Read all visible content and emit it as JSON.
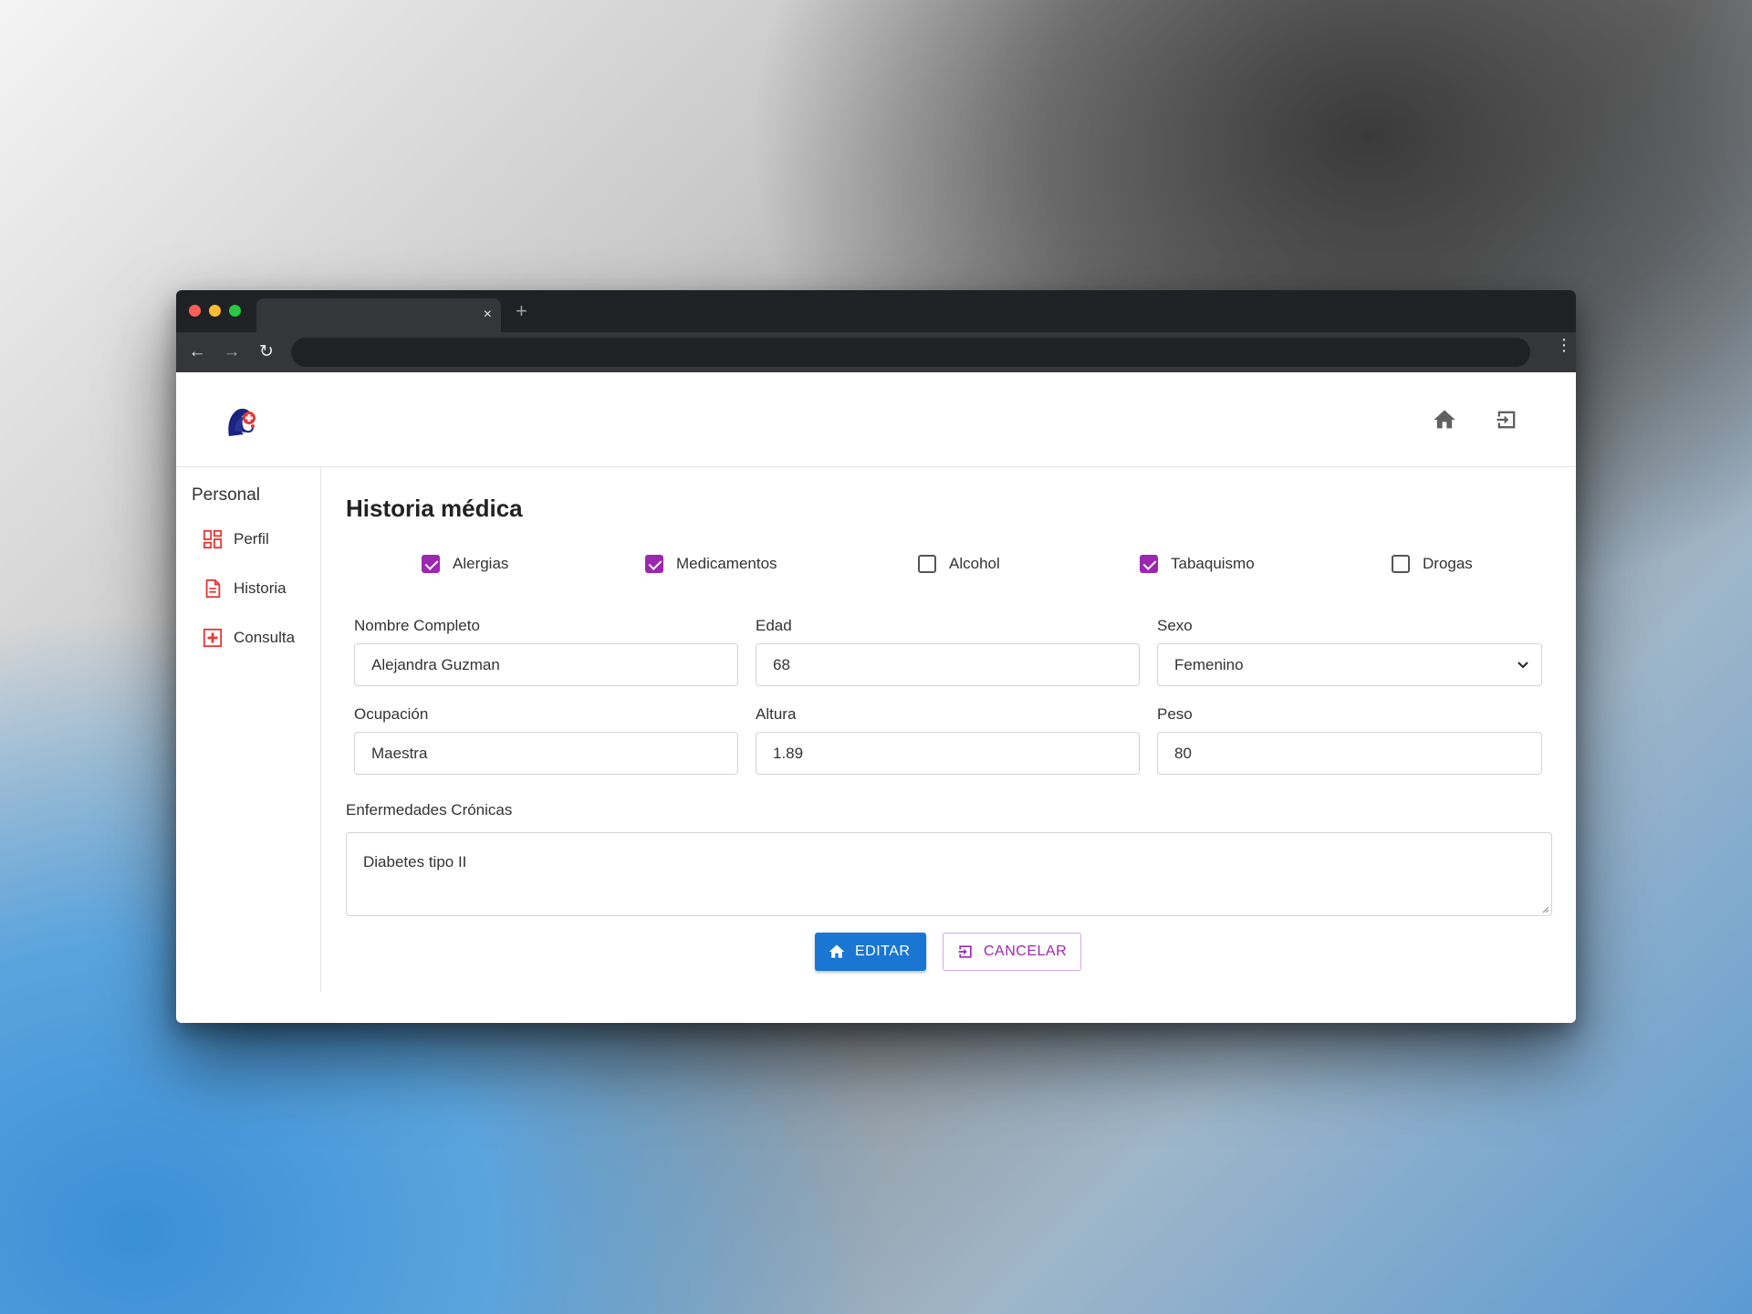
{
  "browser": {
    "tab_close": "×",
    "new_tab": "+",
    "back": "←",
    "forward": "→",
    "reload": "↻",
    "menu": "⋮"
  },
  "header": {
    "logo": "medical-logo",
    "home_icon": "home-icon",
    "logout_icon": "logout-icon"
  },
  "sidebar": {
    "section_title": "Personal",
    "items": [
      {
        "label": "Perfil",
        "icon": "dashboard-icon"
      },
      {
        "label": "Historia",
        "icon": "document-icon"
      },
      {
        "label": "Consulta",
        "icon": "medical-cross-icon"
      }
    ]
  },
  "main": {
    "title": "Historia médica",
    "checkboxes": [
      {
        "label": "Alergias",
        "checked": true
      },
      {
        "label": "Medicamentos",
        "checked": true
      },
      {
        "label": "Alcohol",
        "checked": false
      },
      {
        "label": "Tabaquismo",
        "checked": true
      },
      {
        "label": "Drogas",
        "checked": false
      }
    ],
    "fields": {
      "nombre": {
        "label": "Nombre Completo",
        "value": "Alejandra Guzman"
      },
      "edad": {
        "label": "Edad",
        "value": "68"
      },
      "sexo": {
        "label": "Sexo",
        "value": "Femenino"
      },
      "ocupacion": {
        "label": "Ocupación",
        "value": "Maestra"
      },
      "altura": {
        "label": "Altura",
        "value": "1.89"
      },
      "peso": {
        "label": "Peso",
        "value": "80"
      },
      "enfermedades": {
        "label": "Enfermedades Crónicas",
        "value": "Diabetes tipo II"
      }
    },
    "buttons": {
      "edit": "EDITAR",
      "cancel": "CANCELAR"
    }
  },
  "colors": {
    "accent_purple": "#9c27b0",
    "primary_blue": "#1976d2",
    "sidebar_icon_red": "#e53935"
  }
}
